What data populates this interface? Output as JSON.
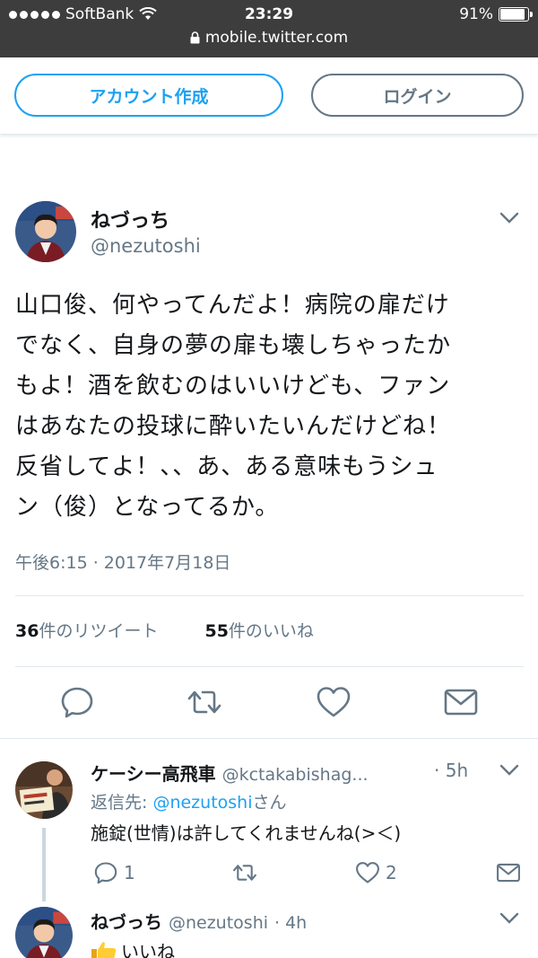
{
  "status_bar": {
    "carrier": "SoftBank",
    "time": "23:29",
    "battery": "91%",
    "url": "mobile.twitter.com"
  },
  "header": {
    "signup_label": "アカウント作成",
    "login_label": "ログイン"
  },
  "tweet": {
    "author_name": "ねづっち",
    "author_handle": "@nezutoshi",
    "lines": [
      "山口俊、何やってんだよ！病院の扉だけ",
      "でなく、自身の夢の扉も壊しちゃったか",
      "もよ！酒を飲むのはいいけども、ファン",
      "はあなたの投球に酔いたいんだけどね！",
      "反省してよ！、、あ、ある意味もうシュ",
      "ン（俊）となってるか。"
    ],
    "timestamp": "午後6:15 · 2017年7月18日",
    "retweet_count": "36",
    "retweet_label": "件のリツイート",
    "like_count": "55",
    "like_label": "件のいいね"
  },
  "replies": [
    {
      "name": "ケーシー高飛車",
      "handle": "@kctakabishag...",
      "time": "· 5h",
      "reply_to_label": "返信先:",
      "reply_to_mention": "@nezutoshi",
      "reply_to_suffix": "さん",
      "text": "施錠(世情)は許してくれませんね(>＜)",
      "reply_count": "1",
      "like_count": "2"
    },
    {
      "name": "ねづっち",
      "handle": "@nezutoshi",
      "time": "· 4h",
      "text": "いいね"
    }
  ],
  "colors": {
    "accent": "#1da1f2",
    "secondary": "#657786",
    "status_bar": "#3d3d3d"
  },
  "icons": [
    "wifi-icon",
    "lock-icon",
    "battery-icon",
    "chevron-down-icon",
    "reply-icon",
    "retweet-icon",
    "like-icon",
    "share-icon",
    "thumbs-up-icon"
  ]
}
